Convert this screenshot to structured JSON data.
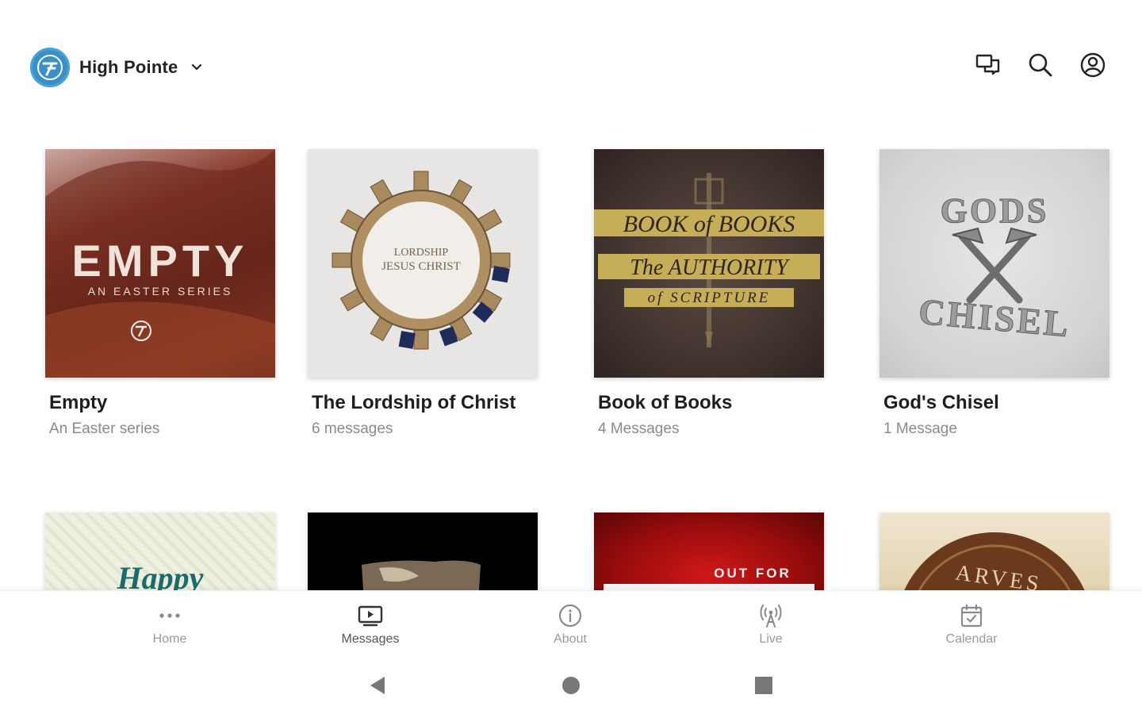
{
  "header": {
    "brand_name": "High Pointe"
  },
  "series": [
    {
      "title": "Empty",
      "subtitle": "An Easter series",
      "art_line1": "EMPTY",
      "art_line2": "AN EASTER SERIES"
    },
    {
      "title": "The Lordship of Christ",
      "subtitle": "6 messages",
      "art_line1": "LORDSHIP",
      "art_line2": "JESUS CHRIST"
    },
    {
      "title": "Book of Books",
      "subtitle": "4 Messages",
      "art_line1": "BOOK of BOOKS",
      "art_line2": "The AUTHORITY",
      "art_line3": "of SCRIPTURE"
    },
    {
      "title": "God's Chisel",
      "subtitle": "1 Message",
      "art_line1": "GODS",
      "art_line2": "CHISEL"
    }
  ],
  "series_row2": [
    {
      "art_text": "Happy"
    },
    {
      "art_text": ""
    },
    {
      "art_text": "OUT FOR"
    },
    {
      "art_text": "ARVES"
    }
  ],
  "bottom_nav": [
    {
      "label": "Home",
      "icon": "more-dots-icon"
    },
    {
      "label": "Messages",
      "icon": "video-icon"
    },
    {
      "label": "About",
      "icon": "info-icon"
    },
    {
      "label": "Live",
      "icon": "broadcast-icon"
    },
    {
      "label": "Calendar",
      "icon": "calendar-icon"
    }
  ],
  "colors": {
    "brand_blue": "#3a8fc6",
    "title_text": "#1e1e1e",
    "subtitle_text": "#8a8a8a",
    "nav_inactive": "#9a9a9a"
  }
}
